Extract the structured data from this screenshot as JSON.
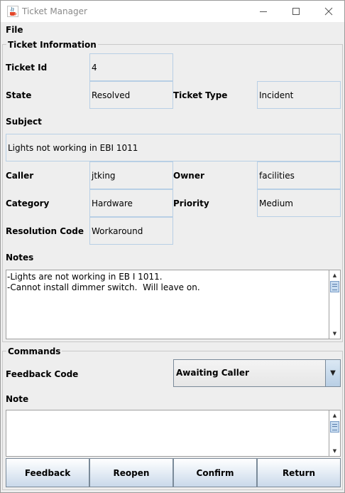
{
  "window": {
    "title": "Ticket Manager",
    "app_icon": "java-coffee-cup-icon"
  },
  "menu": {
    "file": "File"
  },
  "ticket_info": {
    "title": "Ticket Information",
    "ticket_id_label": "Ticket Id",
    "ticket_id": "4",
    "state_label": "State",
    "state": "Resolved",
    "ticket_type_label": "Ticket Type",
    "ticket_type": "Incident",
    "subject_label": "Subject",
    "subject": "Lights not working in EBI 1011",
    "caller_label": "Caller",
    "caller": "jtking",
    "owner_label": "Owner",
    "owner": "facilities",
    "category_label": "Category",
    "category": "Hardware",
    "priority_label": "Priority",
    "priority": "Medium",
    "resolution_code_label": "Resolution Code",
    "resolution_code": "Workaround",
    "notes_label": "Notes",
    "notes": "-Lights are not working in EB I 1011.\n-Cannot install dimmer switch.  Will leave on."
  },
  "commands": {
    "title": "Commands",
    "feedback_code_label": "Feedback Code",
    "feedback_code_selected": "Awaiting Caller",
    "note_label": "Note",
    "note_value": ""
  },
  "buttons": {
    "feedback": "Feedback",
    "reopen": "Reopen",
    "confirm": "Confirm",
    "return": "Return"
  },
  "colors": {
    "field_border": "#b8cfe5",
    "button_gradient_bottom": "#c9d9ea",
    "panel_background": "#eeeeee"
  }
}
